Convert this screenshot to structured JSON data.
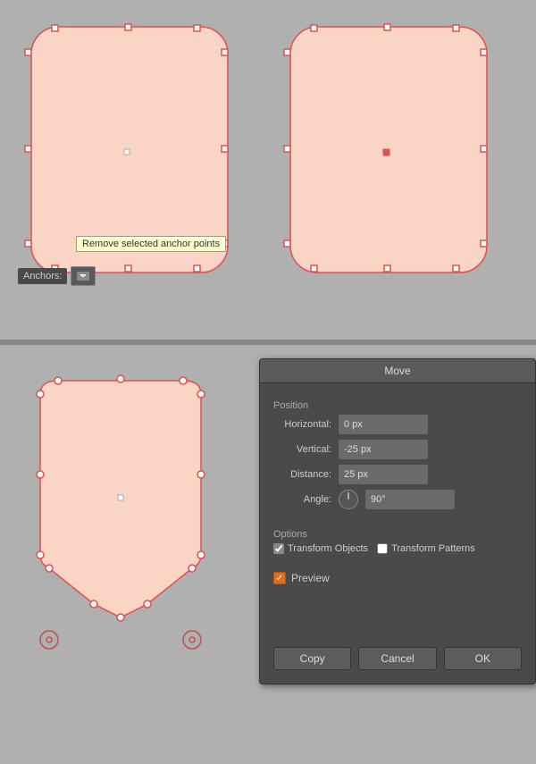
{
  "top_section": {
    "shapes": [
      {
        "id": "left-shape",
        "description": "rounded rectangle with anchor points selected"
      },
      {
        "id": "right-shape",
        "description": "rounded rectangle with one filled anchor"
      }
    ]
  },
  "toolbar": {
    "anchors_label": "Anchors:",
    "remove_anchor_tooltip": "Remove selected anchor points"
  },
  "move_dialog": {
    "title": "Move",
    "position_section": "Position",
    "horizontal_label": "Horizontal:",
    "horizontal_value": "0 px",
    "vertical_label": "Vertical:",
    "vertical_value": "-25 px",
    "distance_label": "Distance:",
    "distance_value": "25 px",
    "angle_label": "Angle:",
    "angle_value": "90°",
    "options_section": "Options",
    "transform_objects_label": "Transform Objects",
    "transform_patterns_label": "Transform Patterns",
    "preview_label": "Preview",
    "copy_btn": "Copy",
    "cancel_btn": "Cancel",
    "ok_btn": "OK"
  }
}
